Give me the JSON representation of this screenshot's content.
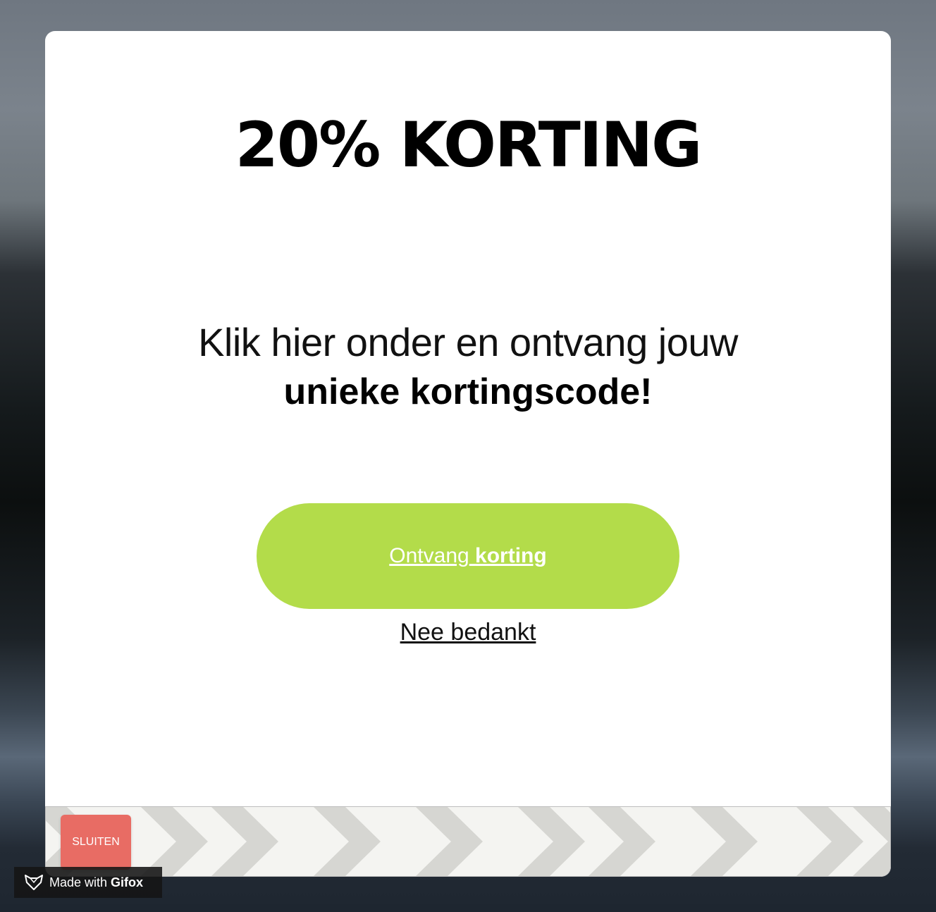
{
  "popup": {
    "headline": "20% KORTING",
    "subtitle_line1": "Klik hier onder en ontvang jouw",
    "subtitle_line2": "unieke kortingscode!",
    "cta_label_regular": "Ontvang",
    "cta_label_bold": "korting",
    "decline_label": "Nee bedankt",
    "cta_color": "#b3dc4a"
  },
  "footer": {
    "close_label": "SLUITEN",
    "close_color": "#e86c64"
  },
  "watermark": {
    "prefix": "Made with",
    "brand": "Gifox",
    "icon": "fox-icon"
  }
}
